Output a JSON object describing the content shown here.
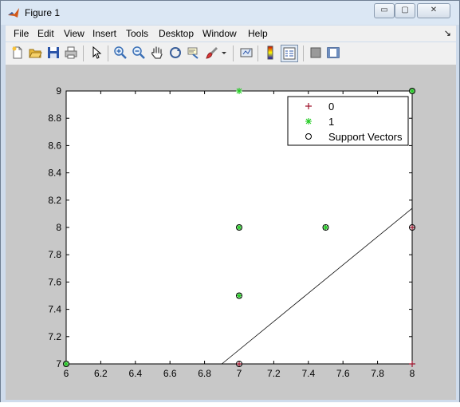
{
  "window": {
    "title": "Figure 1",
    "min_label": "▭",
    "max_label": "▢",
    "close_label": "✕"
  },
  "menu": {
    "items": [
      "File",
      "Edit",
      "View",
      "Insert",
      "Tools",
      "Desktop",
      "Window",
      "Help"
    ],
    "dock_arrow": "↘"
  },
  "toolbar": {
    "icons": [
      "new-figure-icon",
      "open-file-icon",
      "save-icon",
      "print-icon",
      "edit-plot-arrow-icon",
      "zoom-in-icon",
      "zoom-out-icon",
      "pan-hand-icon",
      "rotate-3d-icon",
      "data-cursor-icon",
      "brush-icon",
      "brush-dropdown-icon",
      "link-plot-icon",
      "insert-colorbar-icon",
      "insert-legend-icon",
      "hide-plot-tools-icon",
      "show-plot-tools-icon"
    ]
  },
  "chart_data": {
    "type": "scatter",
    "xlim": [
      6,
      8
    ],
    "ylim": [
      7,
      9
    ],
    "xticks": [
      "6",
      "6.2",
      "6.4",
      "6.6",
      "6.8",
      "7",
      "7.2",
      "7.4",
      "7.6",
      "7.8",
      "8"
    ],
    "yticks": [
      "7",
      "7.2",
      "7.4",
      "7.6",
      "7.8",
      "8",
      "8.2",
      "8.4",
      "8.6",
      "8.8",
      "9"
    ],
    "series": [
      {
        "name": "0",
        "marker": "+",
        "color": "#a0142e",
        "points": [
          [
            7,
            7
          ],
          [
            8,
            8
          ],
          [
            8,
            7
          ]
        ]
      },
      {
        "name": "1",
        "marker": "*",
        "color": "#22cc22",
        "points": [
          [
            6,
            7
          ],
          [
            7,
            7.5
          ],
          [
            7,
            8
          ],
          [
            7.5,
            8
          ],
          [
            7,
            9
          ],
          [
            8,
            9
          ]
        ]
      }
    ],
    "support_vectors": {
      "name": "Support Vectors",
      "points": [
        [
          6,
          7
        ],
        [
          7,
          7
        ],
        [
          7,
          7.5
        ],
        [
          7,
          8
        ],
        [
          7.5,
          8
        ],
        [
          8,
          8
        ],
        [
          8,
          9
        ]
      ]
    },
    "decision_boundary": [
      [
        6.9,
        7
      ],
      [
        8,
        8.14
      ]
    ],
    "legend": {
      "placement": "top-right",
      "entries": [
        "0",
        "1",
        "Support Vectors"
      ]
    },
    "grid": false
  }
}
